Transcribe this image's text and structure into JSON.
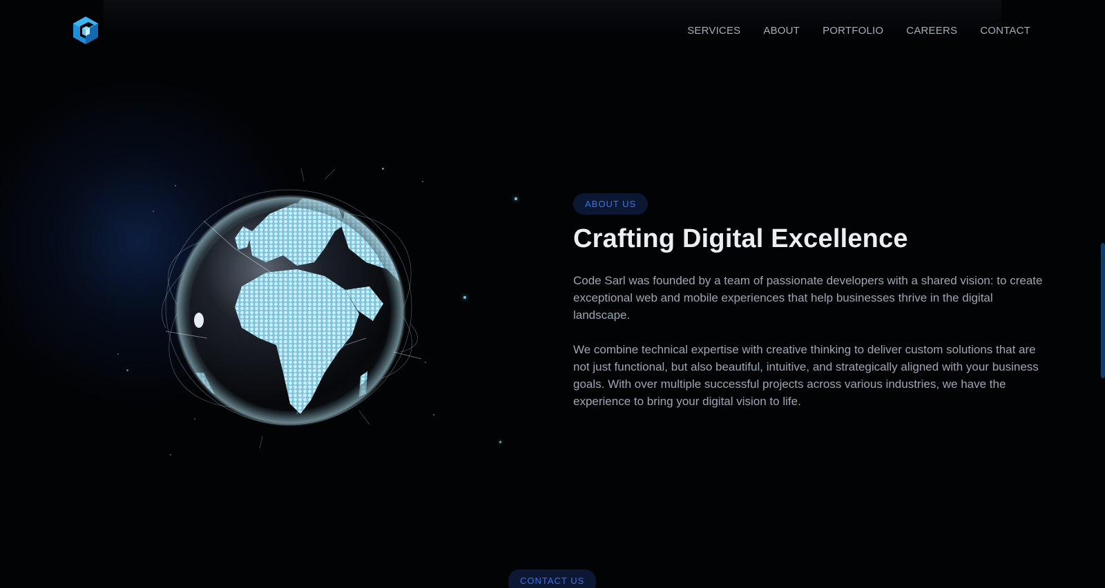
{
  "nav": {
    "logo_icon": "cube-logo-icon",
    "items": [
      {
        "label": "SERVICES"
      },
      {
        "label": "ABOUT"
      },
      {
        "label": "PORTFOLIO"
      },
      {
        "label": "CAREERS"
      },
      {
        "label": "CONTACT"
      }
    ]
  },
  "about": {
    "badge": "ABOUT US",
    "title": "Crafting Digital Excellence",
    "paragraph_1": "Code Sarl was founded by a team of passionate developers with a shared vision: to create exceptional web and mobile experiences that help businesses thrive in the digital landscape.",
    "paragraph_2": "We combine technical expertise with creative thinking to deliver custom solutions that are not just functional, but also beautiful, intuitive, and strategically aligned with your business goals. With over multiple successful projects across various industries, we have the experience to bring your digital vision to life."
  },
  "contact": {
    "badge": "CONTACT US"
  },
  "colors": {
    "background": "#020305",
    "accent": "#3b73e8",
    "badge_bg": "#0b1733",
    "heading": "#eceef2",
    "body_text": "#9ea6b3",
    "globe_land": "#a9dcee"
  }
}
